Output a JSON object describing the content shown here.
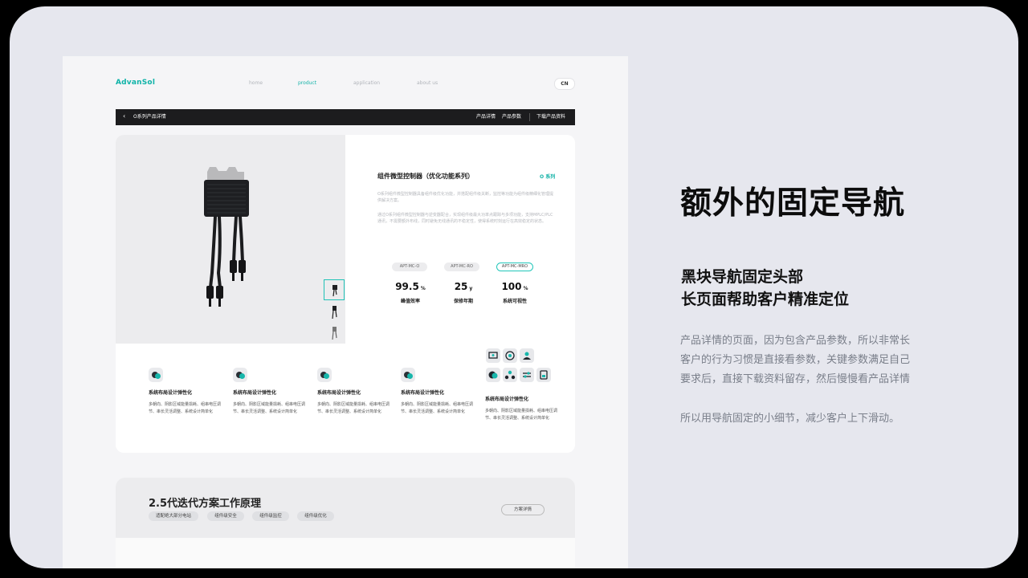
{
  "site": {
    "brand": "AdvanSol",
    "nav": [
      {
        "label": "home",
        "active": false
      },
      {
        "label": "product",
        "active": true
      },
      {
        "label": "application",
        "active": false
      },
      {
        "label": "about us",
        "active": false
      }
    ],
    "lang": "CN"
  },
  "sticky_nav": {
    "back_icon": "chevron-left-icon",
    "title": "O系列产品详情",
    "links": [
      "产品详情",
      "产品参数",
      "下载产品资料"
    ]
  },
  "product": {
    "title": "组件微型控制器（优化功能系列）",
    "series_badge": "O 系列",
    "desc1": "O系列组件微型控制器具备组件级优化功能，并搭配组件级关断，监控等功能为组件级精细化管理提供解决方案。",
    "desc2": "通过O系列组件微型控制器与逆变器配合，实现组件级最大功率点跟踪与多项功能，支持MPLC/PLC通讯，不需要额外布线，同时避免无线通讯的不稳定性，使得系统时刻运行在高效稳定的状态。",
    "models": [
      {
        "label": "APT-MC-O",
        "selected": false
      },
      {
        "label": "APT-MC-RO",
        "selected": false
      },
      {
        "label": "APT-MC-MRO",
        "selected": true
      }
    ],
    "stats": [
      {
        "value": "99.5",
        "unit": "%",
        "label": "峰值效率"
      },
      {
        "value": "25",
        "unit": "y",
        "label": "保修年期"
      },
      {
        "value": "100",
        "unit": "%",
        "label": "系统可视性"
      }
    ],
    "thumbnails": 3
  },
  "features": [
    {
      "title": "系统布局设计弹性化",
      "desc": "多朝向、阴影区域能量损耗、组串电压调节、串长灵活调整、系统设计简单化"
    },
    {
      "title": "系统布局设计弹性化",
      "desc": "多朝向、阴影区域能量损耗、组串电压调节、串长灵活调整、系统设计简单化"
    },
    {
      "title": "系统布局设计弹性化",
      "desc": "多朝向、阴影区域能量损耗、组串电压调节、串长灵活调整、系统设计简单化"
    },
    {
      "title": "系统布局设计弹性化",
      "desc": "多朝向、阴影区域能量损耗、组串电压调节、串长灵活调整、系统设计简单化"
    },
    {
      "title": "系统布局设计弹性化",
      "desc": "多朝向、阴影区域能量损耗、组串电压调节、串长灵活调整、系统设计简单化"
    }
  ],
  "feature_icons": [
    "monitor-icon",
    "wifi-icon",
    "user-icon",
    "chip-icon",
    "group-icon",
    "switch-icon",
    "device-icon"
  ],
  "section2": {
    "title": "2.5代迭代方案工作原理",
    "tags": [
      "适配绝大部分电站",
      "组件级安全",
      "组件级监控",
      "组件级优化"
    ],
    "button": "方案详情"
  },
  "annotation": {
    "title": "额外的固定导航",
    "subtitle_line1": "黑块导航固定头部",
    "subtitle_line2": "长页面帮助客户精准定位",
    "body_line1": "产品详情的页面，因为包含产品参数，所以非常长",
    "body_line2": "客户的行为习惯是直接看参数，关键参数满足自己",
    "body_line3": "要求后，直接下载资料留存，然后慢慢看产品详情",
    "body_line4": "所以用导航固定的小细节，减少客户上下滑动。"
  },
  "colors": {
    "accent": "#16b3a8",
    "dark_nav": "#1c1c1e",
    "canvas": "#e6e7ee"
  }
}
